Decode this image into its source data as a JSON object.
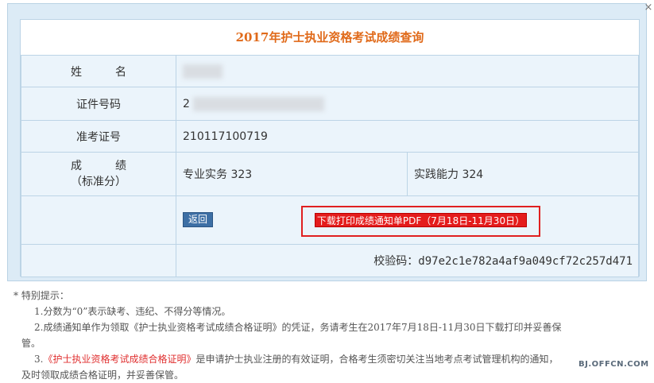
{
  "dialog": {
    "close_symbol": "×",
    "title": "2017年护士执业资格考试成绩查询"
  },
  "rows": {
    "name_label": "姓　　　名",
    "id_label": "证件号码",
    "id_value_prefix": "2",
    "ticket_label": "准考证号",
    "ticket_value": "210117100719",
    "score_label_1": "成　　　绩",
    "score_label_2": "（标准分）",
    "score_professional": "专业实务 323",
    "score_practical": "实践能力 324",
    "back_button": "返回",
    "download_button": "下载打印成绩通知单PDF（7月18日-11月30日）",
    "verify_label": "校验码：",
    "verify_code": "d97e2c1e782a4af9a049cf72c257d471"
  },
  "notes": {
    "heading": "* 特别提示：",
    "item1": "1.分数为“0”表示缺考、违纪、不得分等情况。",
    "item2": "2.成绩通知单作为领取《护士执业资格考试成绩合格证明》的凭证，务请考生在2017年7月18日-11月30日下载打印并妥善保",
    "item2_cont": "管。",
    "item3_prefix": "3.",
    "item3_highlight": "《护士执业资格考试成绩合格证明》",
    "item3_rest": "是申请护士执业注册的有效证明，合格考生须密切关注当地考点考试管理机构的通知，",
    "item3_cont": "及时领取成绩合格证明，并妥善保管。"
  },
  "watermark": "BJ.OFFCN.COM"
}
